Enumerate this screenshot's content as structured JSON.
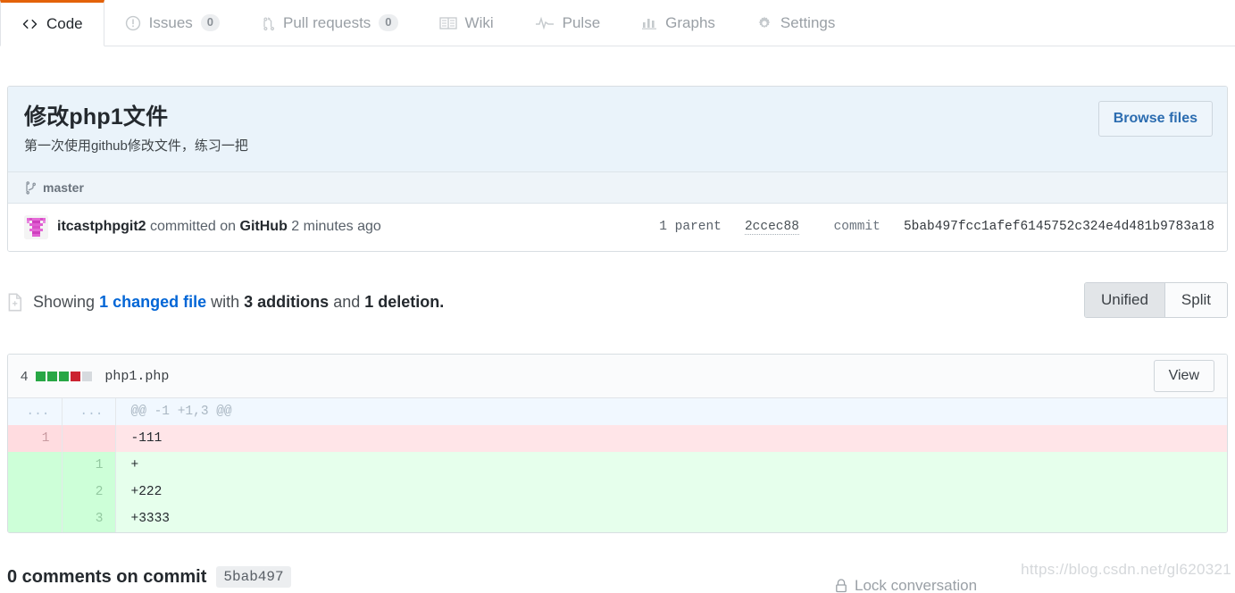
{
  "nav": {
    "tabs": [
      {
        "label": "Code",
        "icon": "code-icon",
        "count": null,
        "active": true
      },
      {
        "label": "Issues",
        "icon": "issue-opened-icon",
        "count": "0",
        "active": false
      },
      {
        "label": "Pull requests",
        "icon": "git-pull-request-icon",
        "count": "0",
        "active": false
      },
      {
        "label": "Wiki",
        "icon": "book-icon",
        "count": null,
        "active": false
      },
      {
        "label": "Pulse",
        "icon": "pulse-icon",
        "count": null,
        "active": false
      },
      {
        "label": "Graphs",
        "icon": "graph-icon",
        "count": null,
        "active": false
      },
      {
        "label": "Settings",
        "icon": "gear-icon",
        "count": null,
        "active": false
      }
    ]
  },
  "commit": {
    "title": "修改php1文件",
    "description": "第一次使用github修改文件，练习一把",
    "browse_files_label": "Browse files",
    "branch": "master",
    "author": "itcastphpgit2",
    "committed_text": "committed on",
    "platform": "GitHub",
    "time_ago": "2 minutes ago",
    "parent_label": "1 parent",
    "parent_sha": "2ccec88",
    "commit_label": "commit",
    "commit_sha": "5bab497fcc1afef6145752c324e4d481b9783a18"
  },
  "summary": {
    "showing": "Showing",
    "changed_files": "1 changed file",
    "with": "with",
    "additions": "3 additions",
    "and": "and",
    "deletions": "1 deletion",
    "period": ".",
    "view_unified": "Unified",
    "view_split": "Split",
    "selected_view": "Unified"
  },
  "file": {
    "changes_count": "4",
    "filename": "php1.php",
    "view_label": "View",
    "diffstat_blocks": [
      "add",
      "add",
      "add",
      "del",
      "empty"
    ],
    "colors": {
      "add": "#28a745",
      "del": "#cb2431",
      "empty": "#d1d5da"
    },
    "diff_lines": [
      {
        "type": "hunk",
        "old": "...",
        "new": "...",
        "text": "@@ -1 +1,3 @@"
      },
      {
        "type": "del",
        "old": "1",
        "new": "",
        "text": "-111"
      },
      {
        "type": "add",
        "old": "",
        "new": "1",
        "text": "+"
      },
      {
        "type": "add",
        "old": "",
        "new": "2",
        "text": "+222"
      },
      {
        "type": "add",
        "old": "",
        "new": "3",
        "text": "+3333"
      }
    ]
  },
  "comments": {
    "heading": "0 comments on commit",
    "sha_badge": "5bab497",
    "lock_text": "Lock conversation"
  },
  "watermark": "https://blog.csdn.net/gl620321"
}
